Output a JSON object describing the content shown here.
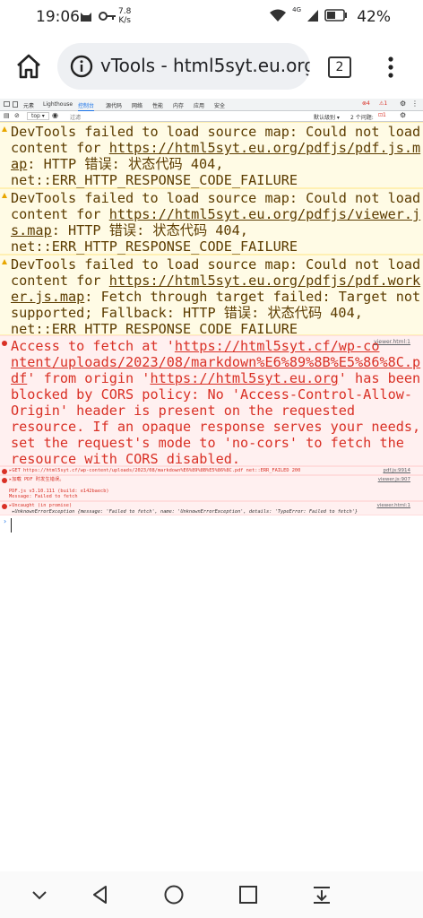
{
  "status_bar": {
    "time": "19:06",
    "speed_value": "7.8",
    "speed_unit": "K/s",
    "network": "4G",
    "battery": "42%"
  },
  "browser": {
    "url": "vTools - html5syt.eu.org",
    "tab_count": "2"
  },
  "devtools": {
    "tabs": [
      "元素",
      "Lighthouse",
      "控制台",
      "源代码",
      "网络",
      "性能",
      "内存",
      "应用",
      "安全"
    ],
    "active_tab": "控制台",
    "warn_count": "4",
    "error_count": "1",
    "context": "top",
    "filter_placeholder": "过滤",
    "level_select": "默认级别",
    "issues": "2 个问题:",
    "issues_count": "1"
  },
  "console": {
    "w1_l1": "DevTools failed to load source map: Could not load",
    "w1_l2a": "content for ",
    "w1_l2b": "https://html5syt.eu.org/pdfjs/pdf.js.m",
    "w1_l3a": "ap",
    "w1_l3b": ": HTTP 错误: 状态代码 404,",
    "w1_l4": "net::ERR_HTTP_RESPONSE_CODE_FAILURE",
    "w2_l1": "DevTools failed to load source map: Could not load",
    "w2_l2a": "content for ",
    "w2_l2b": "https://html5syt.eu.org/pdfjs/viewer.j",
    "w2_l3a": "s.map",
    "w2_l3b": ": HTTP 错误: 状态代码 404,",
    "w2_l4": "net::ERR_HTTP_RESPONSE_CODE_FAILURE",
    "w3_l1": "DevTools failed to load source map: Could not load",
    "w3_l2a": "content for ",
    "w3_l2b": "https://html5syt.eu.org/pdfjs/pdf.work",
    "w3_l3a": "er.js.map",
    "w3_l3b": ": Fetch through target failed: Target not",
    "w3_l4": "supported; Fallback: HTTP 错误: 状态代码 404,",
    "w3_l5": "net::ERR_HTTP_RESPONSE_CODE_FAILURE",
    "e1_src": "viewer.html:1",
    "e1_l1a": "Access to fetch at '",
    "e1_l1b": "https://html5syt.cf/wp-co",
    "e1_l2a": "ntent/uploads/2023/08/markdown%E6%89%8B%E5%86%8C.p",
    "e1_l3a": "df",
    "e1_l3b": "' from origin '",
    "e1_l3c": "https://html5syt.eu.org",
    "e1_l3d": "' has been",
    "e1_l4": "blocked by CORS policy: No 'Access-Control-Allow-",
    "e1_l5": "Origin' header is present on the requested",
    "e1_l6": "resource. If an opaque response serves your needs,",
    "e1_l7": "set the request's mode to 'no-cors' to fetch the",
    "e1_l8": "resource with CORS disabled.",
    "e2_text": "▸GET https://html5syt.cf/wp-content/uploads/2023/08/markdown%E6%89%8B%E5%86%8C.pdf net::ERR_FAILED 200",
    "e2_src": "pdf.js:9914",
    "e3_l1": "▸加载 PDF 时发生错误。",
    "e3_src": "viewer.js:907",
    "e3_l2": "PDF.js v3.10.111 (build: e142baecb)",
    "e3_l3": "Message: Failed to fetch",
    "e4_l1": "▸Uncaught (in promise)",
    "e4_src": "viewer.html:1",
    "e4_l2": " ▸UnknownErrorException {message: 'Failed to fetch', name: 'UnknownErrorException', details: 'TypeError: Failed to fetch'}",
    "prompt": "›"
  }
}
